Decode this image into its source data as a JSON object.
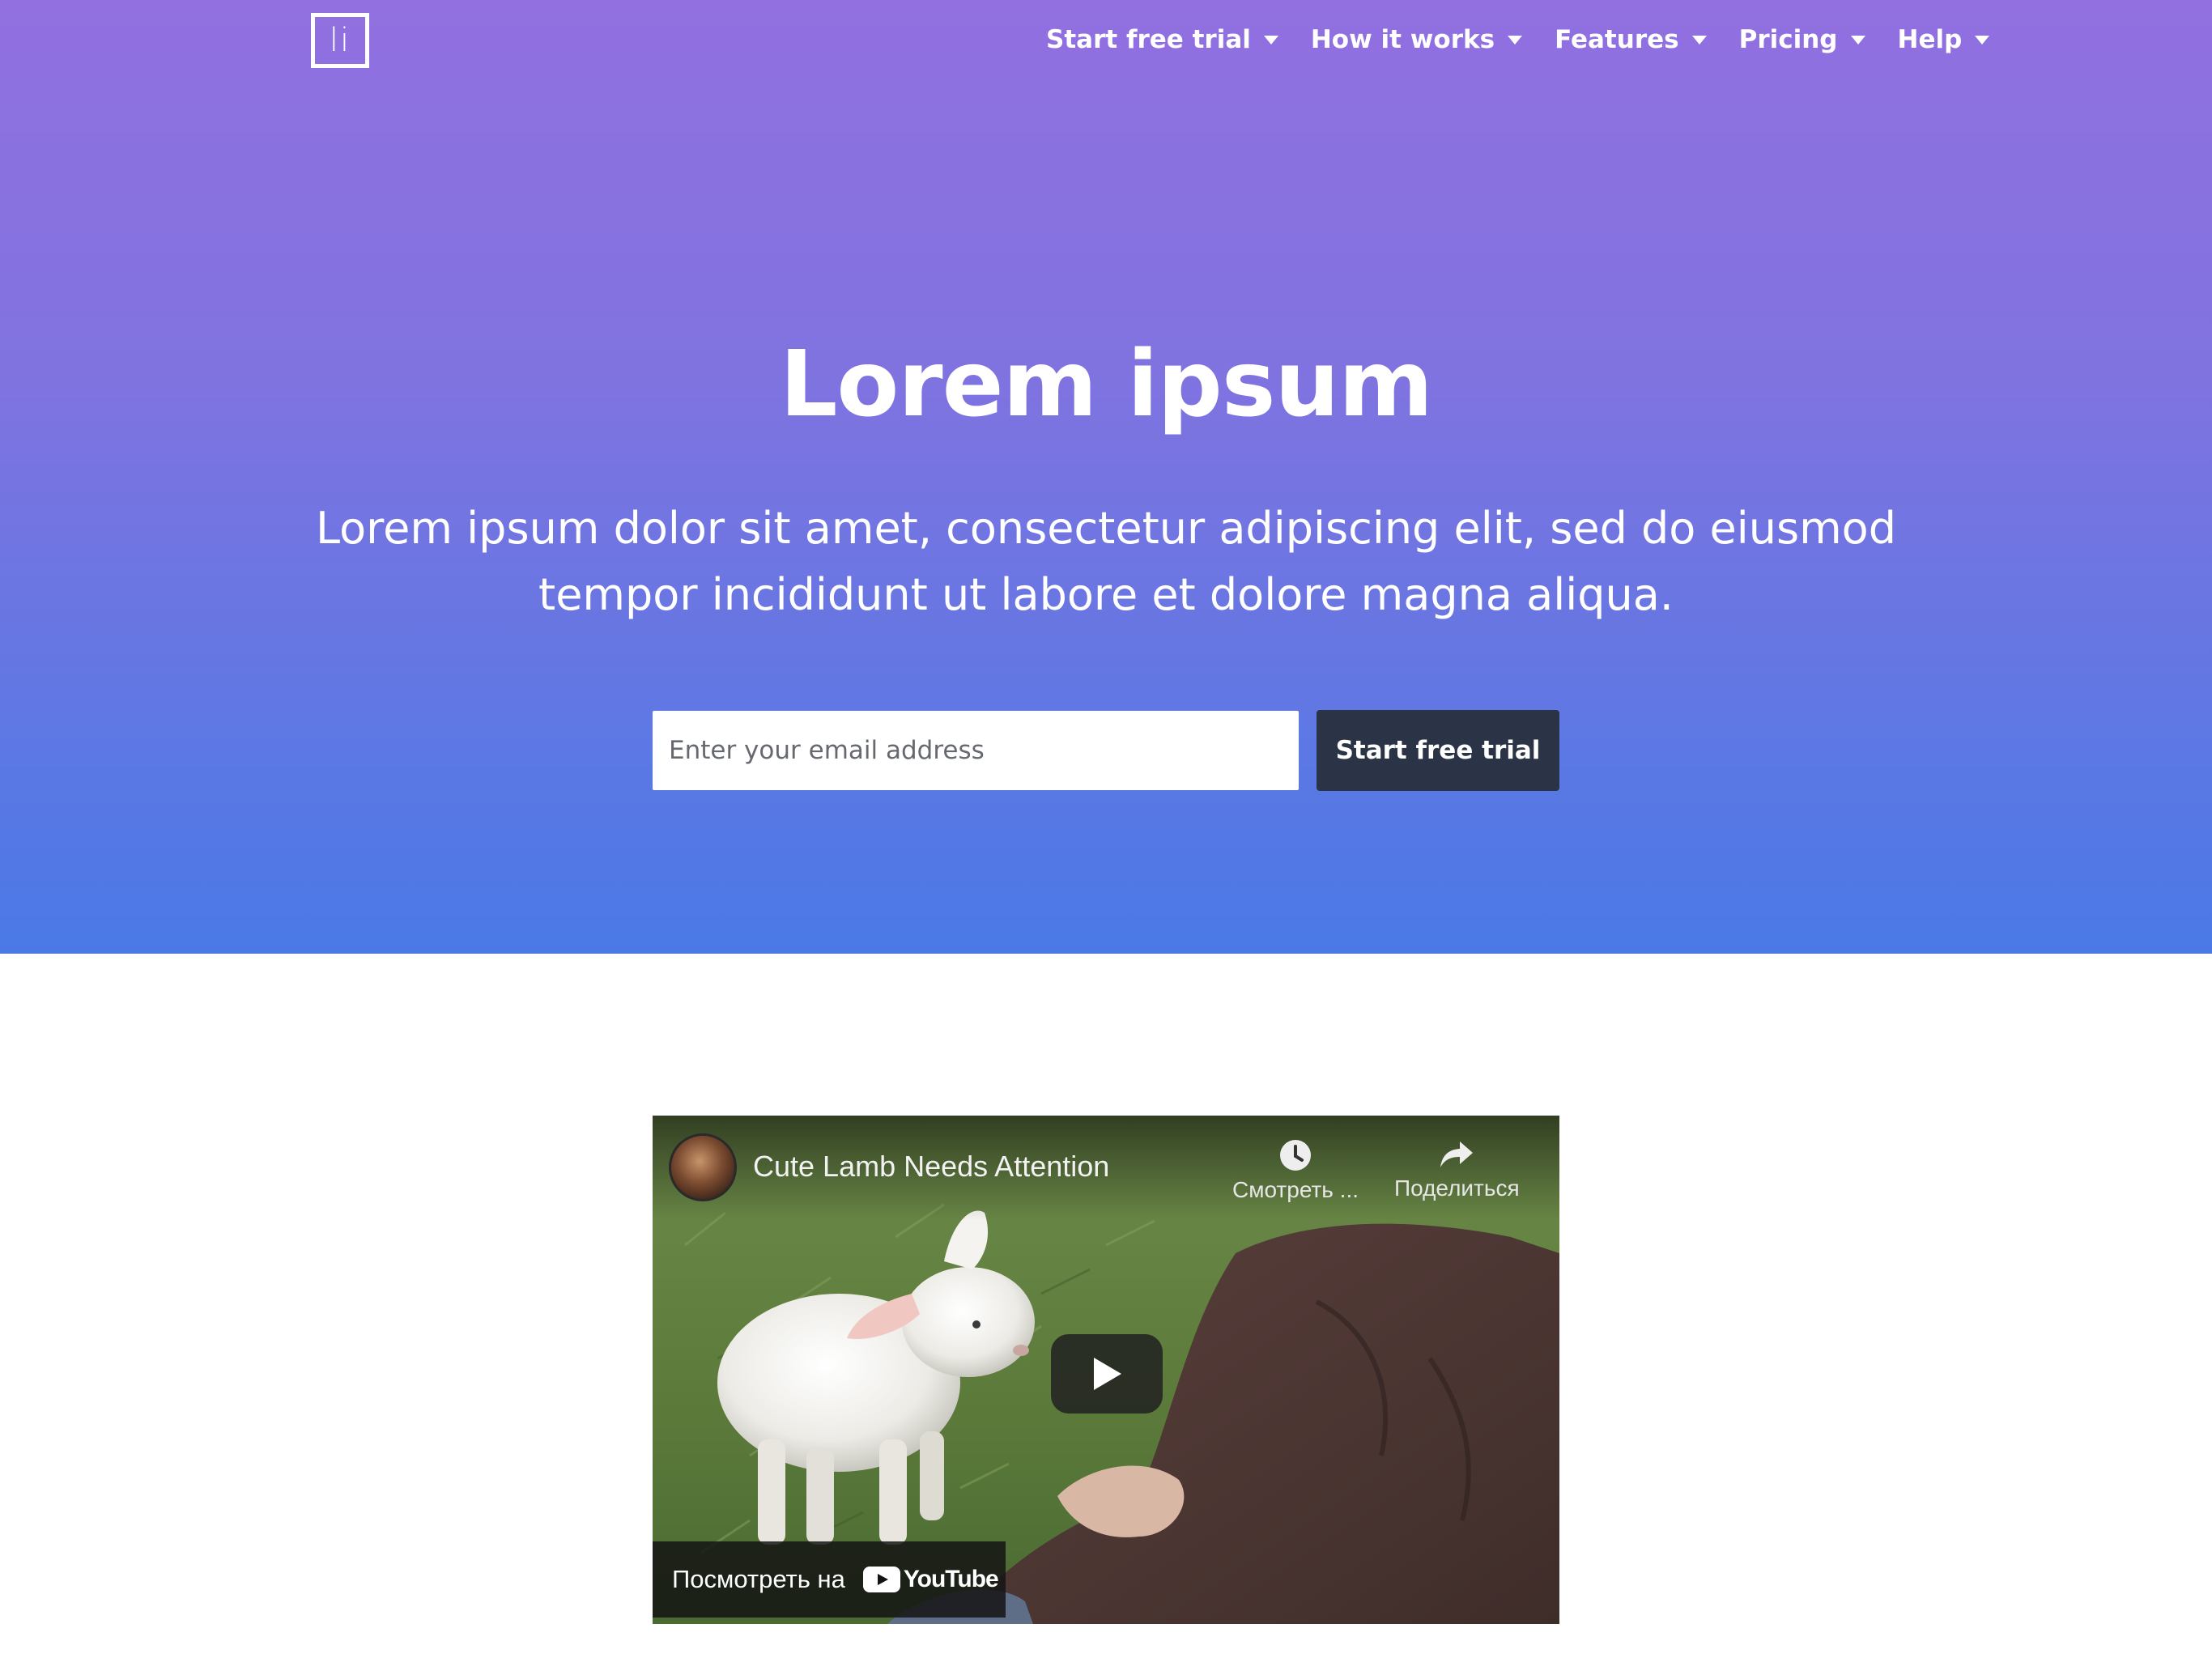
{
  "logo": {
    "text": "li"
  },
  "nav": {
    "items": [
      {
        "label": "Start free trial"
      },
      {
        "label": "How it works"
      },
      {
        "label": "Features"
      },
      {
        "label": "Pricing"
      },
      {
        "label": "Help"
      }
    ]
  },
  "hero": {
    "title": "Lorem ipsum",
    "subtitle_line1": "Lorem ipsum dolor sit amet, consectetur adipiscing elit, sed do eiusmod",
    "subtitle_line2": "tempor incididunt ut labore et dolore magna aliqua.",
    "email_placeholder": "Enter your email address",
    "email_value": "",
    "cta_label": "Start free trial"
  },
  "video": {
    "title": "Cute Lamb Needs Attention",
    "watch_later_label": "Смотреть ...",
    "share_label": "Поделиться",
    "watch_on_label": "Посмотреть на",
    "platform_label": "YouTube"
  },
  "colors": {
    "hero_gradient_top": "#9270e0",
    "hero_gradient_bottom": "#4a79e6",
    "cta_background": "#2b3447",
    "youtube_red": "#ff0000"
  }
}
